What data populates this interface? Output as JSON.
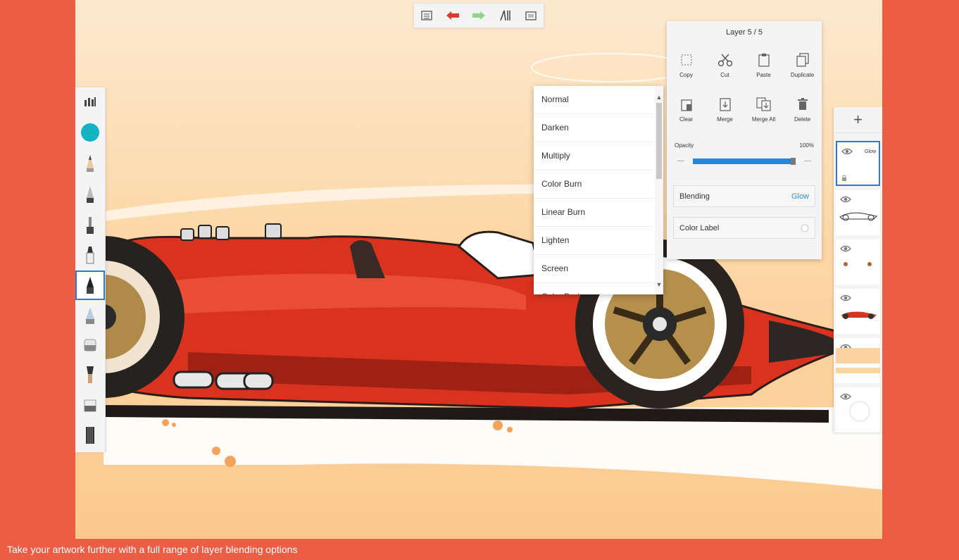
{
  "caption": "Take your artwork further with a full range of layer blending options",
  "toolbar": {
    "icons": [
      "gallery-icon",
      "undo-icon",
      "redo-icon",
      "symmetry-tools-icon",
      "fullscreen-icon"
    ]
  },
  "left_tools": [
    "brush-library-icon",
    "color-puck-icon",
    "pencil-icon",
    "ballpoint-pen-icon",
    "airbrush-icon",
    "marker-icon",
    "chisel-marker-icon",
    "paintbrush-icon",
    "soft-eraser-icon",
    "smudge-brush-icon",
    "hard-eraser-icon",
    "texture-brush-icon"
  ],
  "colors": {
    "accent": "#2a7bd3",
    "color_puck": "#13b3c2",
    "background": "#ec5d45",
    "undo": "#d93a2b",
    "redo": "#8ed58a"
  },
  "blending_menu": {
    "items": [
      "Normal",
      "Darken",
      "Multiply",
      "Color Burn",
      "Linear Burn",
      "Lighten",
      "Screen",
      "Color Dodge"
    ]
  },
  "layer_panel": {
    "title": "Layer 5 / 5",
    "actions": [
      "Copy",
      "Cut",
      "Paste",
      "Duplicate",
      "Clear",
      "Merge",
      "Merge All",
      "Delete"
    ],
    "opacity_label": "Opacity",
    "opacity_value": "100%",
    "opacity_fraction": 1.0,
    "blending_label": "Blending",
    "blending_value": "Glow",
    "color_label": "Color Label"
  },
  "layers": {
    "add_label": "+",
    "selected_layer_name": "Glow"
  }
}
